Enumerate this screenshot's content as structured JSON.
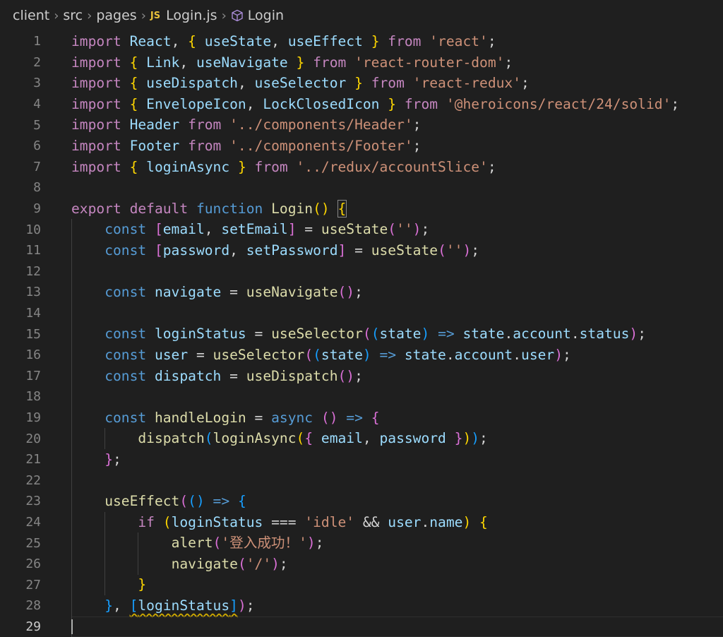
{
  "breadcrumb": {
    "parts": [
      "client",
      "src",
      "pages",
      "Login.js",
      "Login"
    ],
    "js_badge": "JS"
  },
  "editor": {
    "line_numbers": [
      "1",
      "2",
      "3",
      "4",
      "5",
      "6",
      "7",
      "8",
      "9",
      "10",
      "11",
      "12",
      "13",
      "14",
      "15",
      "16",
      "17",
      "18",
      "19",
      "20",
      "21",
      "22",
      "23",
      "24",
      "25",
      "26",
      "27",
      "28",
      "29"
    ],
    "active_line": "29",
    "lines": [
      [
        [
          "k",
          "import"
        ],
        [
          "p",
          " "
        ],
        [
          "v",
          "React"
        ],
        [
          "p",
          ", "
        ],
        [
          "b1",
          "{"
        ],
        [
          "p",
          " "
        ],
        [
          "v",
          "useState"
        ],
        [
          "p",
          ", "
        ],
        [
          "v",
          "useEffect"
        ],
        [
          "p",
          " "
        ],
        [
          "b1",
          "}"
        ],
        [
          "p",
          " "
        ],
        [
          "k",
          "from"
        ],
        [
          "p",
          " "
        ],
        [
          "s",
          "'react'"
        ],
        [
          "p",
          ";"
        ]
      ],
      [
        [
          "k",
          "import"
        ],
        [
          "p",
          " "
        ],
        [
          "b1",
          "{"
        ],
        [
          "p",
          " "
        ],
        [
          "v",
          "Link"
        ],
        [
          "p",
          ", "
        ],
        [
          "v",
          "useNavigate"
        ],
        [
          "p",
          " "
        ],
        [
          "b1",
          "}"
        ],
        [
          "p",
          " "
        ],
        [
          "k",
          "from"
        ],
        [
          "p",
          " "
        ],
        [
          "s",
          "'react-router-dom'"
        ],
        [
          "p",
          ";"
        ]
      ],
      [
        [
          "k",
          "import"
        ],
        [
          "p",
          " "
        ],
        [
          "b1",
          "{"
        ],
        [
          "p",
          " "
        ],
        [
          "v",
          "useDispatch"
        ],
        [
          "p",
          ", "
        ],
        [
          "v",
          "useSelector"
        ],
        [
          "p",
          " "
        ],
        [
          "b1",
          "}"
        ],
        [
          "p",
          " "
        ],
        [
          "k",
          "from"
        ],
        [
          "p",
          " "
        ],
        [
          "s",
          "'react-redux'"
        ],
        [
          "p",
          ";"
        ]
      ],
      [
        [
          "k",
          "import"
        ],
        [
          "p",
          " "
        ],
        [
          "b1",
          "{"
        ],
        [
          "p",
          " "
        ],
        [
          "v",
          "EnvelopeIcon"
        ],
        [
          "p",
          ", "
        ],
        [
          "v",
          "LockClosedIcon"
        ],
        [
          "p",
          " "
        ],
        [
          "b1",
          "}"
        ],
        [
          "p",
          " "
        ],
        [
          "k",
          "from"
        ],
        [
          "p",
          " "
        ],
        [
          "s",
          "'@heroicons/react/24/solid'"
        ],
        [
          "p",
          ";"
        ]
      ],
      [
        [
          "k",
          "import"
        ],
        [
          "p",
          " "
        ],
        [
          "v",
          "Header"
        ],
        [
          "p",
          " "
        ],
        [
          "k",
          "from"
        ],
        [
          "p",
          " "
        ],
        [
          "s",
          "'../components/Header'"
        ],
        [
          "p",
          ";"
        ]
      ],
      [
        [
          "k",
          "import"
        ],
        [
          "p",
          " "
        ],
        [
          "v",
          "Footer"
        ],
        [
          "p",
          " "
        ],
        [
          "k",
          "from"
        ],
        [
          "p",
          " "
        ],
        [
          "s",
          "'../components/Footer'"
        ],
        [
          "p",
          ";"
        ]
      ],
      [
        [
          "k",
          "import"
        ],
        [
          "p",
          " "
        ],
        [
          "b1",
          "{"
        ],
        [
          "p",
          " "
        ],
        [
          "v",
          "loginAsync"
        ],
        [
          "p",
          " "
        ],
        [
          "b1",
          "}"
        ],
        [
          "p",
          " "
        ],
        [
          "k",
          "from"
        ],
        [
          "p",
          " "
        ],
        [
          "s",
          "'../redux/accountSlice'"
        ],
        [
          "p",
          ";"
        ]
      ],
      [],
      [
        [
          "k",
          "export"
        ],
        [
          "p",
          " "
        ],
        [
          "k",
          "default"
        ],
        [
          "p",
          " "
        ],
        [
          "kb",
          "function"
        ],
        [
          "p",
          " "
        ],
        [
          "f",
          "Login"
        ],
        [
          "b1",
          "()"
        ],
        [
          "p",
          " "
        ],
        [
          "b1 matchbox",
          "{"
        ]
      ],
      [
        [
          "p",
          "    "
        ],
        [
          "kb",
          "const"
        ],
        [
          "p",
          " "
        ],
        [
          "b2",
          "["
        ],
        [
          "v",
          "email"
        ],
        [
          "p",
          ", "
        ],
        [
          "v",
          "setEmail"
        ],
        [
          "b2",
          "]"
        ],
        [
          "p",
          " = "
        ],
        [
          "f",
          "useState"
        ],
        [
          "b2",
          "("
        ],
        [
          "s",
          "''"
        ],
        [
          "b2",
          ")"
        ],
        [
          "p",
          ";"
        ]
      ],
      [
        [
          "p",
          "    "
        ],
        [
          "kb",
          "const"
        ],
        [
          "p",
          " "
        ],
        [
          "b2",
          "["
        ],
        [
          "v",
          "password"
        ],
        [
          "p",
          ", "
        ],
        [
          "v",
          "setPassword"
        ],
        [
          "b2",
          "]"
        ],
        [
          "p",
          " = "
        ],
        [
          "f",
          "useState"
        ],
        [
          "b2",
          "("
        ],
        [
          "s",
          "''"
        ],
        [
          "b2",
          ")"
        ],
        [
          "p",
          ";"
        ]
      ],
      [],
      [
        [
          "p",
          "    "
        ],
        [
          "kb",
          "const"
        ],
        [
          "p",
          " "
        ],
        [
          "v",
          "navigate"
        ],
        [
          "p",
          " = "
        ],
        [
          "f",
          "useNavigate"
        ],
        [
          "b2",
          "()"
        ],
        [
          "p",
          ";"
        ]
      ],
      [],
      [
        [
          "p",
          "    "
        ],
        [
          "kb",
          "const"
        ],
        [
          "p",
          " "
        ],
        [
          "v",
          "loginStatus"
        ],
        [
          "p",
          " = "
        ],
        [
          "f",
          "useSelector"
        ],
        [
          "b2",
          "("
        ],
        [
          "b3",
          "("
        ],
        [
          "v",
          "state"
        ],
        [
          "b3",
          ")"
        ],
        [
          "p",
          " "
        ],
        [
          "kb",
          "=>"
        ],
        [
          "p",
          " "
        ],
        [
          "v",
          "state"
        ],
        [
          "p",
          "."
        ],
        [
          "v",
          "account"
        ],
        [
          "p",
          "."
        ],
        [
          "v",
          "status"
        ],
        [
          "b2",
          ")"
        ],
        [
          "p",
          ";"
        ]
      ],
      [
        [
          "p",
          "    "
        ],
        [
          "kb",
          "const"
        ],
        [
          "p",
          " "
        ],
        [
          "v",
          "user"
        ],
        [
          "p",
          " = "
        ],
        [
          "f",
          "useSelector"
        ],
        [
          "b2",
          "("
        ],
        [
          "b3",
          "("
        ],
        [
          "v",
          "state"
        ],
        [
          "b3",
          ")"
        ],
        [
          "p",
          " "
        ],
        [
          "kb",
          "=>"
        ],
        [
          "p",
          " "
        ],
        [
          "v",
          "state"
        ],
        [
          "p",
          "."
        ],
        [
          "v",
          "account"
        ],
        [
          "p",
          "."
        ],
        [
          "v",
          "user"
        ],
        [
          "b2",
          ")"
        ],
        [
          "p",
          ";"
        ]
      ],
      [
        [
          "p",
          "    "
        ],
        [
          "kb",
          "const"
        ],
        [
          "p",
          " "
        ],
        [
          "v",
          "dispatch"
        ],
        [
          "p",
          " = "
        ],
        [
          "f",
          "useDispatch"
        ],
        [
          "b2",
          "()"
        ],
        [
          "p",
          ";"
        ]
      ],
      [],
      [
        [
          "p",
          "    "
        ],
        [
          "kb",
          "const"
        ],
        [
          "p",
          " "
        ],
        [
          "f",
          "handleLogin"
        ],
        [
          "p",
          " = "
        ],
        [
          "kb",
          "async"
        ],
        [
          "p",
          " "
        ],
        [
          "b2",
          "()"
        ],
        [
          "p",
          " "
        ],
        [
          "kb",
          "=>"
        ],
        [
          "p",
          " "
        ],
        [
          "b2",
          "{"
        ]
      ],
      [
        [
          "p",
          "        "
        ],
        [
          "f",
          "dispatch"
        ],
        [
          "b3",
          "("
        ],
        [
          "f",
          "loginAsync"
        ],
        [
          "b1",
          "("
        ],
        [
          "b2",
          "{"
        ],
        [
          "p",
          " "
        ],
        [
          "v",
          "email"
        ],
        [
          "p",
          ", "
        ],
        [
          "v",
          "password"
        ],
        [
          "p",
          " "
        ],
        [
          "b2",
          "}"
        ],
        [
          "b1",
          ")"
        ],
        [
          "b3",
          ")"
        ],
        [
          "p",
          ";"
        ]
      ],
      [
        [
          "p",
          "    "
        ],
        [
          "b2",
          "}"
        ],
        [
          "p",
          ";"
        ]
      ],
      [],
      [
        [
          "p",
          "    "
        ],
        [
          "f",
          "useEffect"
        ],
        [
          "b2",
          "("
        ],
        [
          "b3",
          "()"
        ],
        [
          "p",
          " "
        ],
        [
          "kb",
          "=>"
        ],
        [
          "p",
          " "
        ],
        [
          "b3",
          "{"
        ]
      ],
      [
        [
          "p",
          "        "
        ],
        [
          "k",
          "if"
        ],
        [
          "p",
          " "
        ],
        [
          "b1",
          "("
        ],
        [
          "v",
          "loginStatus"
        ],
        [
          "p",
          " === "
        ],
        [
          "s",
          "'idle'"
        ],
        [
          "p",
          " && "
        ],
        [
          "v",
          "user"
        ],
        [
          "p",
          "."
        ],
        [
          "v",
          "name"
        ],
        [
          "b1",
          ")"
        ],
        [
          "p",
          " "
        ],
        [
          "b1",
          "{"
        ]
      ],
      [
        [
          "p",
          "            "
        ],
        [
          "f",
          "alert"
        ],
        [
          "b2",
          "("
        ],
        [
          "s",
          "'登入成功！'"
        ],
        [
          "b2",
          ")"
        ],
        [
          "p",
          ";"
        ]
      ],
      [
        [
          "p",
          "            "
        ],
        [
          "f",
          "navigate"
        ],
        [
          "b2",
          "("
        ],
        [
          "s",
          "'/'"
        ],
        [
          "b2",
          ")"
        ],
        [
          "p",
          ";"
        ]
      ],
      [
        [
          "p",
          "        "
        ],
        [
          "b1",
          "}"
        ]
      ],
      [
        [
          "p",
          "    "
        ],
        [
          "b3",
          "}"
        ],
        [
          "p",
          ", "
        ],
        [
          "b3 squig",
          "["
        ],
        [
          "v squig",
          "loginStatus"
        ],
        [
          "b3 squig",
          "]"
        ],
        [
          "b2",
          ")"
        ],
        [
          "p",
          ";"
        ]
      ],
      []
    ]
  }
}
